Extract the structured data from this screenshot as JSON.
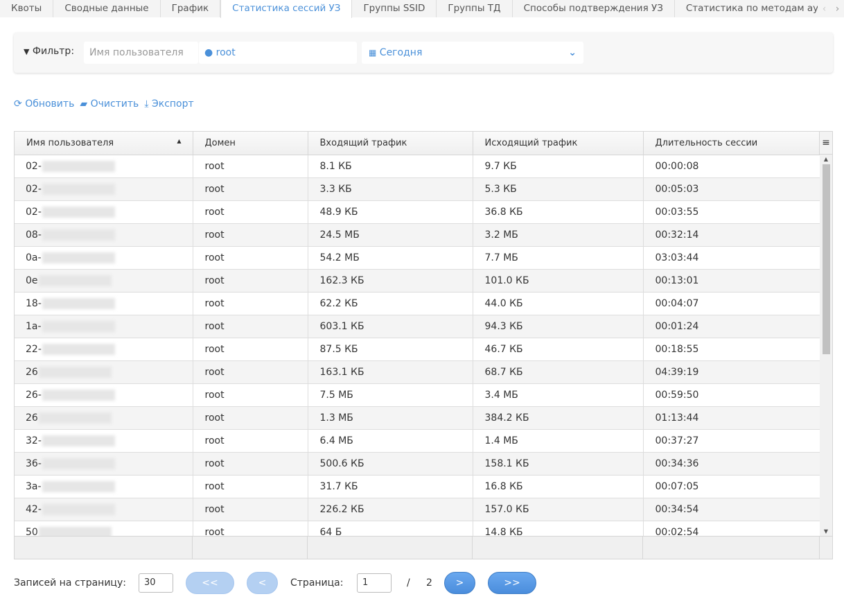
{
  "tabs": [
    "Квоты",
    "Сводные данные",
    "График",
    "Статистика сессий УЗ",
    "Группы SSID",
    "Группы ТД",
    "Способы подтверждения УЗ",
    "Статистика по методам ау"
  ],
  "active_tab": 3,
  "filter": {
    "label": "Фильтр:",
    "username_placeholder": "Имя пользователя",
    "domain_value": "root",
    "period_value": "Сегодня"
  },
  "actions": {
    "refresh": "Обновить",
    "clear": "Очистить",
    "export": "Экспорт"
  },
  "table": {
    "columns": [
      "Имя пользователя",
      "Домен",
      "Входящий трафик",
      "Исходящий трафик",
      "Длительность сессии"
    ],
    "rows": [
      [
        "02-",
        "root",
        "8.1 КБ",
        "9.7 КБ",
        "00:00:08"
      ],
      [
        "02-",
        "root",
        "3.3 КБ",
        "5.3 КБ",
        "00:05:03"
      ],
      [
        "02-",
        "root",
        "48.9 КБ",
        "36.8 КБ",
        "00:03:55"
      ],
      [
        "08-",
        "root",
        "24.5 МБ",
        "3.2 МБ",
        "00:32:14"
      ],
      [
        "0a-",
        "root",
        "54.2 МБ",
        "7.7 МБ",
        "03:03:44"
      ],
      [
        "0e",
        "root",
        "162.3 КБ",
        "101.0 КБ",
        "00:13:01"
      ],
      [
        "18-",
        "root",
        "62.2 КБ",
        "44.0 КБ",
        "00:04:07"
      ],
      [
        "1a-",
        "root",
        "603.1 КБ",
        "94.3 КБ",
        "00:01:24"
      ],
      [
        "22-",
        "root",
        "87.5 КБ",
        "46.7 КБ",
        "00:18:55"
      ],
      [
        "26",
        "root",
        "163.1 КБ",
        "68.7 КБ",
        "04:39:19"
      ],
      [
        "26-",
        "root",
        "7.5 МБ",
        "3.4 МБ",
        "00:59:50"
      ],
      [
        "26",
        "root",
        "1.3 МБ",
        "384.2 КБ",
        "01:13:44"
      ],
      [
        "32-",
        "root",
        "6.4 МБ",
        "1.4 МБ",
        "00:37:27"
      ],
      [
        "36-",
        "root",
        "500.6 КБ",
        "158.1 КБ",
        "00:34:36"
      ],
      [
        "3a-",
        "root",
        "31.7 КБ",
        "16.8 КБ",
        "00:07:05"
      ],
      [
        "42-",
        "root",
        "226.2 КБ",
        "157.0 КБ",
        "00:34:54"
      ],
      [
        "50",
        "root",
        "64 Б",
        "14.8 КБ",
        "00:02:54"
      ]
    ]
  },
  "pager": {
    "per_page_label": "Записей на страницу:",
    "per_page": "30",
    "first": "<<",
    "prev": "<",
    "page_label": "Страница:",
    "page": "1",
    "sep": "/",
    "total_pages": "2",
    "next": ">",
    "last": ">>"
  }
}
